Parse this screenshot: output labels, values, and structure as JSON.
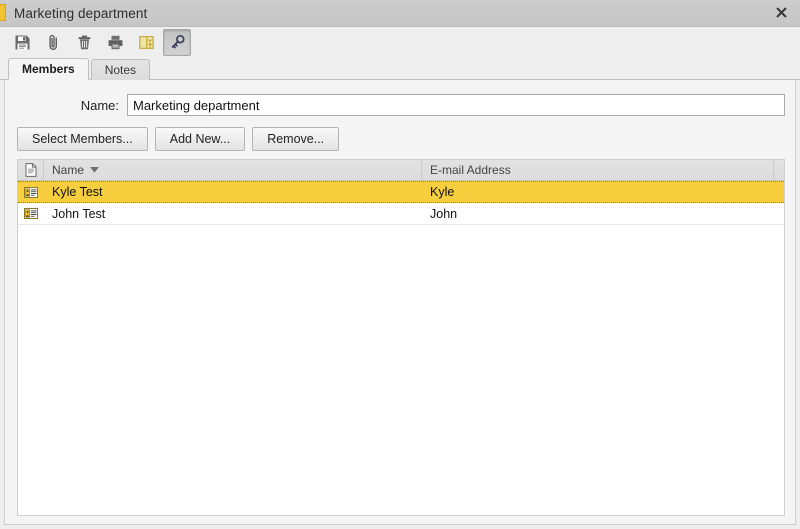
{
  "window": {
    "title": "Marketing department",
    "icon": "window-icon",
    "close_label": "×"
  },
  "toolbar": {
    "buttons": [
      {
        "name": "save-button",
        "icon": "floppy-disk-icon",
        "pressed": false
      },
      {
        "name": "attach-button",
        "icon": "paperclip-icon",
        "pressed": false
      },
      {
        "name": "delete-button",
        "icon": "trash-icon",
        "pressed": false
      },
      {
        "name": "print-button",
        "icon": "printer-icon",
        "pressed": false
      },
      {
        "name": "categories-button",
        "icon": "table-grid-icon",
        "pressed": false
      },
      {
        "name": "permissions-button",
        "icon": "key-icon",
        "pressed": true
      }
    ]
  },
  "tabs": [
    {
      "label": "Members",
      "active": true
    },
    {
      "label": "Notes",
      "active": false
    }
  ],
  "form": {
    "name_label": "Name:",
    "name_value": "Marketing department",
    "name_placeholder": ""
  },
  "actions": [
    {
      "label": "Select Members...",
      "name": "select-members-button"
    },
    {
      "label": "Add New...",
      "name": "add-new-button"
    },
    {
      "label": "Remove...",
      "name": "remove-button"
    }
  ],
  "table": {
    "columns": [
      {
        "label": "",
        "name": "column-icon"
      },
      {
        "label": "Name",
        "name": "column-name",
        "sort": "desc"
      },
      {
        "label": "E-mail Address",
        "name": "column-email"
      }
    ],
    "rows": [
      {
        "icon": "contact-card-icon",
        "name": "Kyle Test",
        "email": "Kyle",
        "selected": true
      },
      {
        "icon": "contact-card-icon",
        "name": "John Test",
        "email": "John",
        "selected": false
      }
    ]
  },
  "colors": {
    "selection": "#f7cf3e",
    "accent": "#e8c44a",
    "titlebar": "#c9c9c9",
    "panel": "#f4f4f4"
  }
}
